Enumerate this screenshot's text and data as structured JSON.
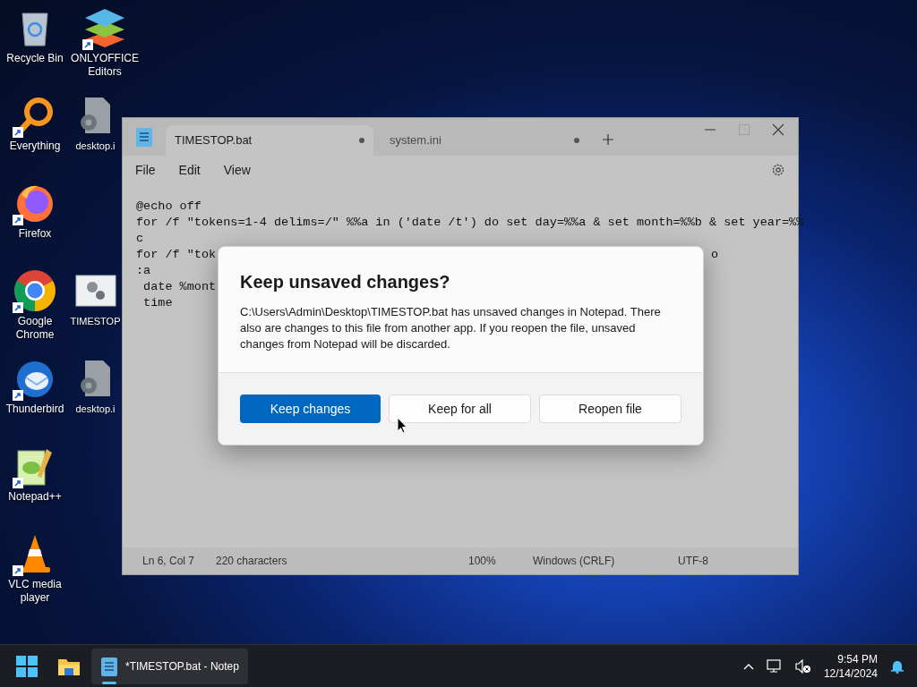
{
  "desktop": {
    "rows": [
      [
        {
          "kind": "recycle-bin",
          "label": "Recycle Bin",
          "shortcut": false
        },
        {
          "kind": "onlyoffice",
          "label": "ONLYOFFICE Editors",
          "shortcut": true
        }
      ],
      [
        {
          "kind": "everything",
          "label": "Everything",
          "shortcut": true
        },
        {
          "kind": "file",
          "label": "desktop.i",
          "shortcut": false
        }
      ],
      [
        {
          "kind": "firefox",
          "label": "Firefox",
          "shortcut": true
        }
      ],
      [
        {
          "kind": "chrome",
          "label": "Google Chrome",
          "shortcut": true
        },
        {
          "kind": "settings-file",
          "label": "TIMESTOP",
          "shortcut": false
        }
      ],
      [
        {
          "kind": "thunderbird",
          "label": "Thunderbird",
          "shortcut": true
        },
        {
          "kind": "file",
          "label": "desktop.i",
          "shortcut": false
        }
      ],
      [
        {
          "kind": "notepadpp",
          "label": "Notepad++",
          "shortcut": true
        }
      ],
      [
        {
          "kind": "vlc",
          "label": "VLC media player",
          "shortcut": true
        }
      ]
    ]
  },
  "notepad": {
    "tabs": [
      {
        "label": "TIMESTOP.bat",
        "selected": true,
        "modified": true
      },
      {
        "label": "system.ini",
        "selected": false,
        "modified": true
      }
    ],
    "menu": [
      "File",
      "Edit",
      "View"
    ],
    "lines": [
      {
        "text": "@echo off"
      },
      {
        "text": "for /f \"tokens=1-4 delims=/\" %%a in ('date /t') do set day=%%a & set month=%%b & set year=%%"
      },
      {
        "text": "c"
      },
      {
        "text": "for /f \"tok",
        "tail": "o"
      },
      {
        "text": ":a"
      },
      {
        "text": " date %mont"
      },
      {
        "text": " time"
      }
    ],
    "status_bar": [
      "Ln 6, Col 7",
      "220 characters",
      "100%",
      "Windows (CRLF)",
      "UTF-8"
    ]
  },
  "dialog": {
    "title": "Keep unsaved changes?",
    "message": "C:\\Users\\Admin\\Desktop\\TIMESTOP.bat has unsaved changes in Notepad. There also are changes to this file from another app. If you reopen the file, unsaved changes from Notepad will be discarded.",
    "buttons": [
      {
        "label": "Keep changes",
        "primary": true
      },
      {
        "label": "Keep for all",
        "primary": false
      },
      {
        "label": "Reopen file",
        "primary": false
      }
    ]
  },
  "taskbar": {
    "apps": [
      {
        "kind": "start",
        "active": false
      },
      {
        "kind": "explorer",
        "active": false
      },
      {
        "kind": "notepad",
        "label": "*TIMESTOP.bat - Notep",
        "active": true
      }
    ],
    "time": "9:54 PM",
    "date": "12/14/2024"
  }
}
